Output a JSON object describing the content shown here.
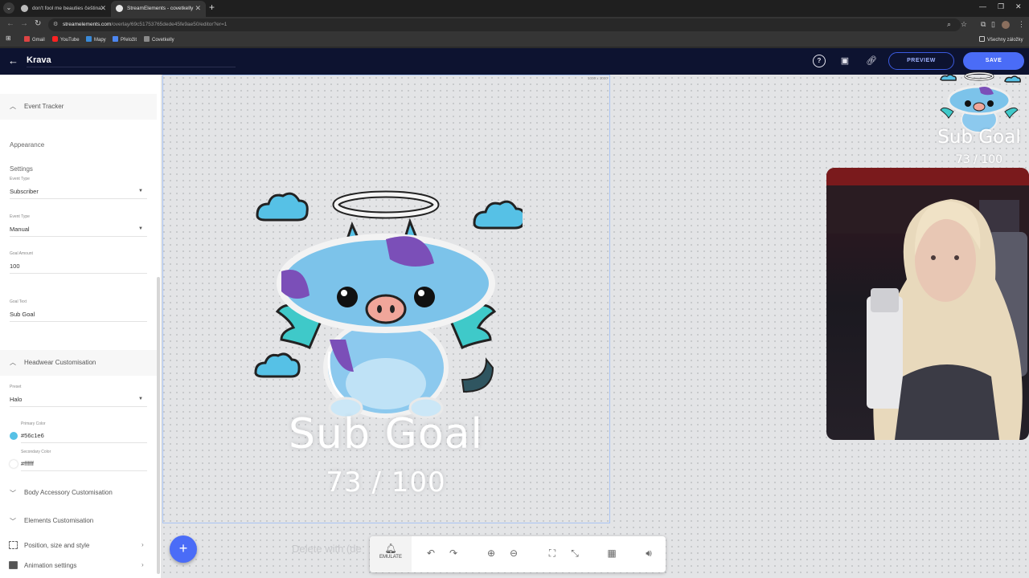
{
  "browser": {
    "tabs": [
      {
        "title": "don't fool me beauties čeština",
        "active": false
      },
      {
        "title": "StreamElements - covetkelly",
        "active": true
      }
    ],
    "url_host": "streamelements.com",
    "url_path": "/overlay/69c51753765dede45fe9ae50/editor?er=1",
    "bookmarks": [
      "Gmail",
      "YouTube",
      "Mapy",
      "Přeložit",
      "Covetkelly"
    ],
    "bookmarks_right": "Všechny záložky"
  },
  "header": {
    "project_name": "Krava",
    "preview_label": "PREVIEW",
    "save_label": "SAVE"
  },
  "sidebar": {
    "event_tracker": "Event Tracker",
    "appearance": "Appearance",
    "settings": "Settings",
    "event_type_1_label": "Event Type",
    "event_type_1_value": "Subscriber",
    "event_type_2_label": "Event Type",
    "event_type_2_value": "Manual",
    "goal_amount_label": "Goal Amount",
    "goal_amount_value": "100",
    "goal_text_label": "Goal Text",
    "goal_text_value": "Sub Goal",
    "headwear": "Headwear Customisation",
    "preset_label": "Preset",
    "preset_value": "Halo",
    "primary_color_label": "Primary Color",
    "primary_color_value": "#56c1e6",
    "secondary_color_label": "Secondary Color",
    "secondary_color_value": "#ffffff",
    "body_accessory": "Body Accessory Customisation",
    "elements": "Elements Customisation",
    "position": "Position, size and style",
    "animation": "Animation settings"
  },
  "canvas": {
    "stage_size": "1000 x 1000",
    "goal_title": "Sub Goal",
    "goal_count": "73 / 100",
    "mini_title": "Sub Goal",
    "mini_count": "73 / 100",
    "delete_hint": "Delete with (de",
    "emulate_label": "EMULATE"
  },
  "colors": {
    "accent": "#4a6cf7",
    "header_bg": "#0d1330",
    "cloud": "#56c1e6",
    "cow_blue": "#7cc3ea",
    "cow_purple": "#7b4fb8",
    "wing": "#3fc9c9"
  },
  "icons": [
    "back-arrow-icon",
    "help-icon",
    "screen-icon",
    "link-icon",
    "bell-icon",
    "undo-icon",
    "redo-icon",
    "zoom-in-icon",
    "zoom-out-icon",
    "fullscreen-icon",
    "exit-fullscreen-icon",
    "grid-icon",
    "volume-icon",
    "plus-icon",
    "chevron-up-icon",
    "chevron-down-icon",
    "chevron-right-icon"
  ]
}
